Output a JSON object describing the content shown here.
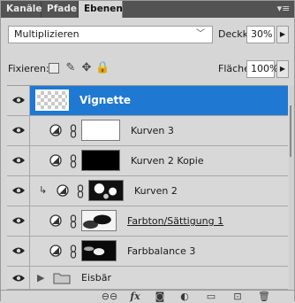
{
  "tabs": [
    {
      "label": "Kanäle"
    },
    {
      "label": "Pfade"
    },
    {
      "label": "Ebenen"
    }
  ],
  "blend_mode": {
    "value": "Multiplizieren"
  },
  "opacity": {
    "label": "Deckkraft:",
    "value": "30%"
  },
  "lock": {
    "label": "Fixieren:"
  },
  "fill": {
    "label": "Fläche:",
    "value": "100%"
  },
  "layers": [
    {
      "name": "Vignette"
    },
    {
      "name": "Kurven 3"
    },
    {
      "name": "Kurven 2 Kopie"
    },
    {
      "name": "Kurven 2"
    },
    {
      "name": "Farbton/Sättigung 1"
    },
    {
      "name": "Farbbalance 3"
    },
    {
      "name": "Eisbär"
    }
  ],
  "bottom_icons": [
    "link-layers-icon",
    "fx-icon",
    "add-mask-icon",
    "adjustment-layer-icon",
    "new-group-icon",
    "new-layer-icon",
    "delete-icon"
  ],
  "colors": {
    "selection": "#1f78d1",
    "panel": "#d6d6d6",
    "tabbar": "#535353"
  }
}
